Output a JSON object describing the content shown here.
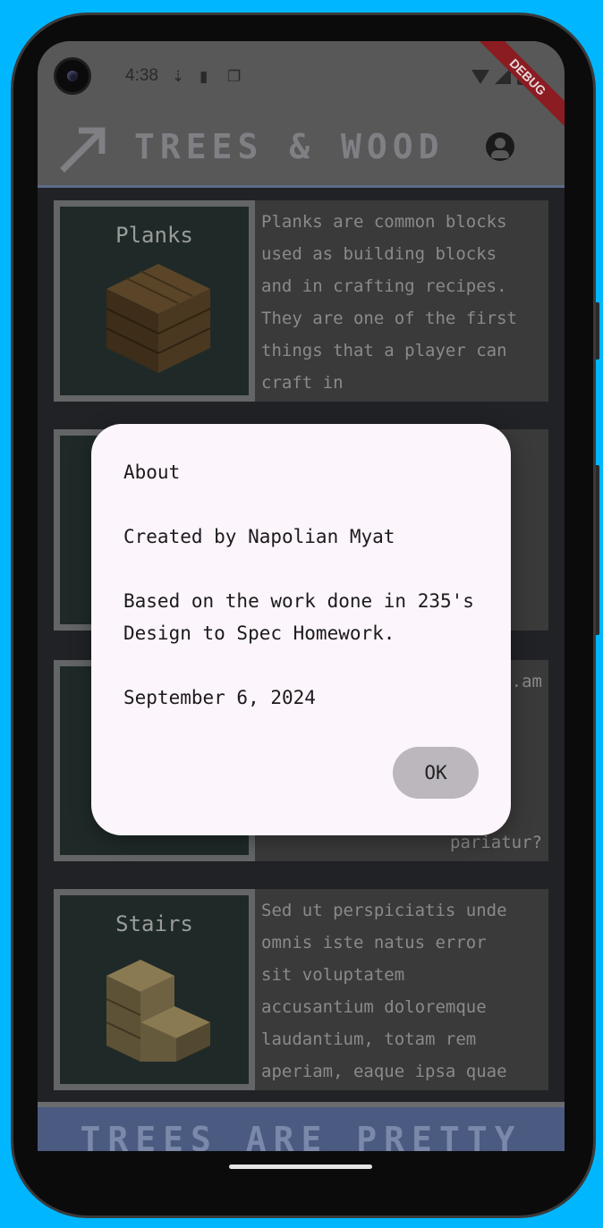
{
  "status_bar": {
    "time": "4:38"
  },
  "debug_banner": "DEBUG",
  "app_bar": {
    "title": "TREES & WOOD"
  },
  "cards": [
    {
      "label": "Planks",
      "text": "Planks are common blocks\nused as building blocks\nand in crafting recipes.\nThey are one of the first\nthings that a player can\ncraft in"
    },
    {
      "label": "",
      "text": ""
    },
    {
      "label": "",
      "text": "...am\n\n\n\n\npariatur?"
    },
    {
      "label": "Stairs",
      "text": "Sed ut perspiciatis unde\nomnis iste natus error\nsit voluptatem\naccusantium doloremque\nlaudantium, totam rem\naperiam, eaque ipsa quae"
    }
  ],
  "bottom_banner": "TREES ARE PRETTY",
  "dialog": {
    "title": "About",
    "line1": "Created by Napolian Myat",
    "line2a": "Based on the work done in 235's",
    "line2b": "Design to Spec Homework.",
    "date": "September 6, 2024",
    "ok_label": "OK"
  },
  "colors": {
    "background": "#00b7ff",
    "dialog": "#fcf5fb",
    "debug": "#8b1c22"
  }
}
